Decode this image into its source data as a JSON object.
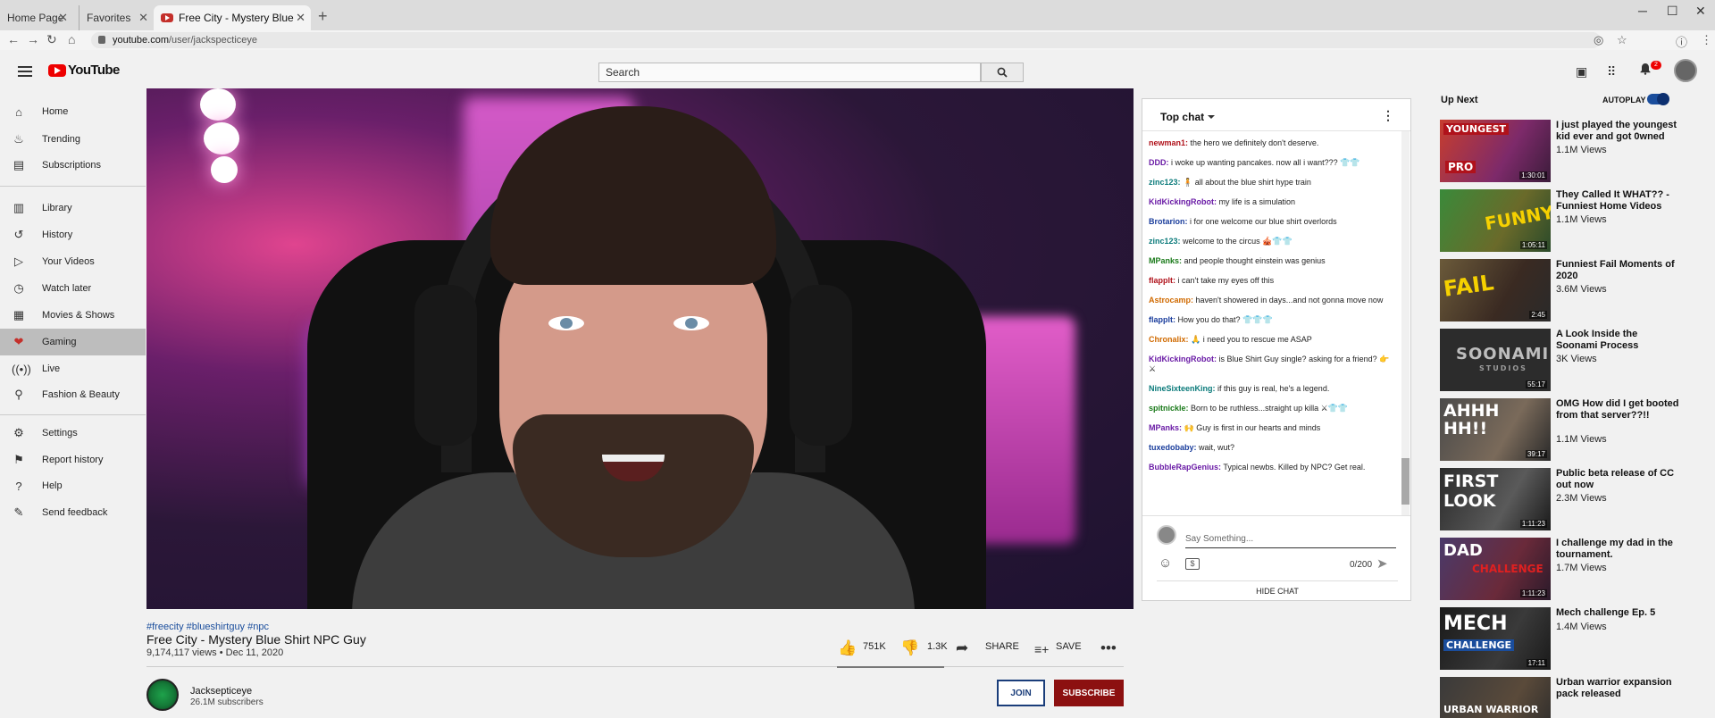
{
  "browser": {
    "tabs": [
      {
        "label": "Home Page"
      },
      {
        "label": "Favorites"
      },
      {
        "label": "Free City - Mystery Blue Shirt"
      }
    ],
    "url_host": "youtube.com",
    "url_path": "/user/jackspecticeye"
  },
  "header": {
    "logo_text": "YouTube",
    "search_placeholder": "Search",
    "notification_count": "2"
  },
  "sidebar": {
    "items": [
      {
        "label": "Home",
        "icon": "home-icon"
      },
      {
        "label": "Trending",
        "icon": "flame-icon"
      },
      {
        "label": "Subscriptions",
        "icon": "subscriptions-icon"
      },
      {
        "label": "Library",
        "icon": "library-icon"
      },
      {
        "label": "History",
        "icon": "history-icon"
      },
      {
        "label": "Your Videos",
        "icon": "your-videos-icon"
      },
      {
        "label": "Watch later",
        "icon": "clock-icon"
      },
      {
        "label": "Movies & Shows",
        "icon": "movies-icon"
      },
      {
        "label": "Gaming",
        "icon": "gaming-icon"
      },
      {
        "label": "Live",
        "icon": "live-icon"
      },
      {
        "label": "Fashion & Beauty",
        "icon": "hanger-icon"
      },
      {
        "label": "Settings",
        "icon": "gear-icon"
      },
      {
        "label": "Report history",
        "icon": "flag-icon"
      },
      {
        "label": "Help",
        "icon": "help-icon"
      },
      {
        "label": "Send feedback",
        "icon": "feedback-icon"
      }
    ],
    "active": "Gaming"
  },
  "chat": {
    "title": "Top chat",
    "messages": [
      {
        "user": "newman1:",
        "text": "the hero we definitely don't deserve.",
        "color": "#b0121b"
      },
      {
        "user": "DDD:",
        "text": "i woke up wanting pancakes. now all i want??? 👕👕",
        "color": "#6a1ba6"
      },
      {
        "user": "zinc123:",
        "text": "🧍 all about the blue shirt hype train",
        "color": "#0a7a7a"
      },
      {
        "user": "KidKickingRobot:",
        "text": "my life is a simulation",
        "color": "#6a1ba6"
      },
      {
        "user": "Brotarion:",
        "text": "i for one welcome our blue shirt overlords",
        "color": "#1a3d9c"
      },
      {
        "user": "zinc123:",
        "text": "welcome to the circus 🎪👕👕",
        "color": "#0a7a7a"
      },
      {
        "user": "MPanks:",
        "text": "and people thought einstein was genius",
        "color": "#1a7a1a"
      },
      {
        "user": "flapplt:",
        "text": "i can't take my eyes off this",
        "color": "#b0121b"
      },
      {
        "user": "Astrocamp:",
        "text": "haven't showered in days...and not gonna move now",
        "color": "#d06a00"
      },
      {
        "user": "flapplt:",
        "text": "How you do that? 👕👕👕",
        "color": "#1a3d9c"
      },
      {
        "user": "Chronalix:",
        "text": "🙏 i need you to rescue me ASAP",
        "color": "#d06a00"
      },
      {
        "user": "KidKickingRobot:",
        "text": "is Blue Shirt Guy single? asking for a friend? 👉 ⚔",
        "color": "#6a1ba6"
      },
      {
        "user": "NineSixteenKing:",
        "text": "if this guy is real, he's a legend.",
        "color": "#0a7a7a"
      },
      {
        "user": "spitnickle:",
        "text": "Born to be ruthless...straight up killa ⚔👕👕",
        "color": "#1a7a1a"
      },
      {
        "user": "MPanks:",
        "text": "🙌 Guy is first in our hearts and minds",
        "color": "#6a1ba6"
      },
      {
        "user": "tuxedobaby:",
        "text": "wait, wut?",
        "color": "#1a3d9c"
      },
      {
        "user": "BubbleRapGenius:",
        "text": "Typical newbs. Killed by NPC? Get real.",
        "color": "#6a1ba6"
      }
    ],
    "input_placeholder": "Say Something...",
    "char_count": "0/200",
    "hide_label": "HIDE CHAT"
  },
  "video": {
    "tags": "#freecity #blueshirtguy #npc",
    "title": "Free City - Mystery Blue Shirt NPC Guy",
    "meta": "9,174,117 views • Dec 11, 2020",
    "likes": "751K",
    "dislikes": "1.3K",
    "share_label": "SHARE",
    "save_label": "SAVE"
  },
  "channel": {
    "name": "Jacksepticeye",
    "subscribers": "26.1M subscribers",
    "join_label": "JOIN",
    "subscribe_label": "SUBSCRIBE"
  },
  "upnext": {
    "title": "Up Next",
    "autoplay_label": "AUTOPLAY",
    "autoplay_on": true,
    "items": [
      {
        "title": "I just played the youngest kid ever and got 0wned",
        "views": "1.1M Views",
        "duration": "1:30:01",
        "thumb_text": "YOUNGEST PRO"
      },
      {
        "title": "They Called It WHAT?? - Funniest Home Videos",
        "views": "1.1M Views",
        "duration": "1:05:11",
        "thumb_text": "FUNNY"
      },
      {
        "title": "Funniest Fail Moments of 2020",
        "views": "3.6M Views",
        "duration": "2:45",
        "thumb_text": "FAIL"
      },
      {
        "title": "A Look Inside the Soonami Process",
        "views": "3K Views",
        "duration": "55:17",
        "thumb_text": "SOONAMI STUDIOS"
      },
      {
        "title": "OMG How did I get booted from that server??!!",
        "views": "1.1M Views",
        "duration": "39:17",
        "thumb_text": "AHHH HH!!"
      },
      {
        "title": "Public beta release of CC out now",
        "views": "2.3M Views",
        "duration": "1:11:23",
        "thumb_text": "FIRST LOOK"
      },
      {
        "title": "I challenge my dad in the tournament.",
        "views": "1.7M Views",
        "duration": "1:11:23",
        "thumb_text": "DAD CHALLENGE"
      },
      {
        "title": "Mech challenge Ep. 5",
        "views": "1.4M Views",
        "duration": "17:11",
        "thumb_text": "MECH CHALLENGE"
      },
      {
        "title": "Urban warrior expansion pack released",
        "views": "",
        "duration": "",
        "thumb_text": "URBAN WARRIOR"
      }
    ]
  }
}
